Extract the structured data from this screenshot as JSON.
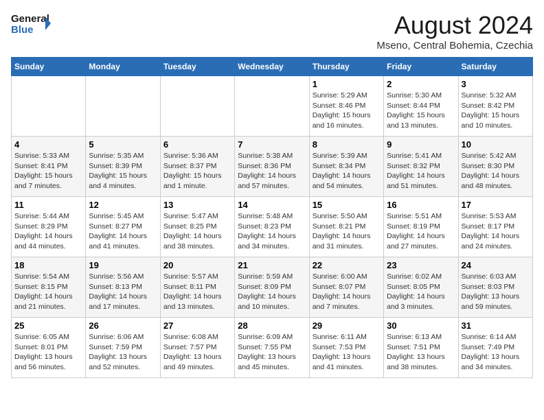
{
  "header": {
    "logo_text_general": "General",
    "logo_text_blue": "Blue",
    "month_year": "August 2024",
    "location": "Mseno, Central Bohemia, Czechia"
  },
  "days_of_week": [
    "Sunday",
    "Monday",
    "Tuesday",
    "Wednesday",
    "Thursday",
    "Friday",
    "Saturday"
  ],
  "weeks": [
    [
      {
        "day": "",
        "info": ""
      },
      {
        "day": "",
        "info": ""
      },
      {
        "day": "",
        "info": ""
      },
      {
        "day": "",
        "info": ""
      },
      {
        "day": "1",
        "info": "Sunrise: 5:29 AM\nSunset: 8:46 PM\nDaylight: 15 hours and 16 minutes."
      },
      {
        "day": "2",
        "info": "Sunrise: 5:30 AM\nSunset: 8:44 PM\nDaylight: 15 hours and 13 minutes."
      },
      {
        "day": "3",
        "info": "Sunrise: 5:32 AM\nSunset: 8:42 PM\nDaylight: 15 hours and 10 minutes."
      }
    ],
    [
      {
        "day": "4",
        "info": "Sunrise: 5:33 AM\nSunset: 8:41 PM\nDaylight: 15 hours and 7 minutes."
      },
      {
        "day": "5",
        "info": "Sunrise: 5:35 AM\nSunset: 8:39 PM\nDaylight: 15 hours and 4 minutes."
      },
      {
        "day": "6",
        "info": "Sunrise: 5:36 AM\nSunset: 8:37 PM\nDaylight: 15 hours and 1 minute."
      },
      {
        "day": "7",
        "info": "Sunrise: 5:38 AM\nSunset: 8:36 PM\nDaylight: 14 hours and 57 minutes."
      },
      {
        "day": "8",
        "info": "Sunrise: 5:39 AM\nSunset: 8:34 PM\nDaylight: 14 hours and 54 minutes."
      },
      {
        "day": "9",
        "info": "Sunrise: 5:41 AM\nSunset: 8:32 PM\nDaylight: 14 hours and 51 minutes."
      },
      {
        "day": "10",
        "info": "Sunrise: 5:42 AM\nSunset: 8:30 PM\nDaylight: 14 hours and 48 minutes."
      }
    ],
    [
      {
        "day": "11",
        "info": "Sunrise: 5:44 AM\nSunset: 8:29 PM\nDaylight: 14 hours and 44 minutes."
      },
      {
        "day": "12",
        "info": "Sunrise: 5:45 AM\nSunset: 8:27 PM\nDaylight: 14 hours and 41 minutes."
      },
      {
        "day": "13",
        "info": "Sunrise: 5:47 AM\nSunset: 8:25 PM\nDaylight: 14 hours and 38 minutes."
      },
      {
        "day": "14",
        "info": "Sunrise: 5:48 AM\nSunset: 8:23 PM\nDaylight: 14 hours and 34 minutes."
      },
      {
        "day": "15",
        "info": "Sunrise: 5:50 AM\nSunset: 8:21 PM\nDaylight: 14 hours and 31 minutes."
      },
      {
        "day": "16",
        "info": "Sunrise: 5:51 AM\nSunset: 8:19 PM\nDaylight: 14 hours and 27 minutes."
      },
      {
        "day": "17",
        "info": "Sunrise: 5:53 AM\nSunset: 8:17 PM\nDaylight: 14 hours and 24 minutes."
      }
    ],
    [
      {
        "day": "18",
        "info": "Sunrise: 5:54 AM\nSunset: 8:15 PM\nDaylight: 14 hours and 21 minutes."
      },
      {
        "day": "19",
        "info": "Sunrise: 5:56 AM\nSunset: 8:13 PM\nDaylight: 14 hours and 17 minutes."
      },
      {
        "day": "20",
        "info": "Sunrise: 5:57 AM\nSunset: 8:11 PM\nDaylight: 14 hours and 13 minutes."
      },
      {
        "day": "21",
        "info": "Sunrise: 5:59 AM\nSunset: 8:09 PM\nDaylight: 14 hours and 10 minutes."
      },
      {
        "day": "22",
        "info": "Sunrise: 6:00 AM\nSunset: 8:07 PM\nDaylight: 14 hours and 7 minutes."
      },
      {
        "day": "23",
        "info": "Sunrise: 6:02 AM\nSunset: 8:05 PM\nDaylight: 14 hours and 3 minutes."
      },
      {
        "day": "24",
        "info": "Sunrise: 6:03 AM\nSunset: 8:03 PM\nDaylight: 13 hours and 59 minutes."
      }
    ],
    [
      {
        "day": "25",
        "info": "Sunrise: 6:05 AM\nSunset: 8:01 PM\nDaylight: 13 hours and 56 minutes."
      },
      {
        "day": "26",
        "info": "Sunrise: 6:06 AM\nSunset: 7:59 PM\nDaylight: 13 hours and 52 minutes."
      },
      {
        "day": "27",
        "info": "Sunrise: 6:08 AM\nSunset: 7:57 PM\nDaylight: 13 hours and 49 minutes."
      },
      {
        "day": "28",
        "info": "Sunrise: 6:09 AM\nSunset: 7:55 PM\nDaylight: 13 hours and 45 minutes."
      },
      {
        "day": "29",
        "info": "Sunrise: 6:11 AM\nSunset: 7:53 PM\nDaylight: 13 hours and 41 minutes."
      },
      {
        "day": "30",
        "info": "Sunrise: 6:13 AM\nSunset: 7:51 PM\nDaylight: 13 hours and 38 minutes."
      },
      {
        "day": "31",
        "info": "Sunrise: 6:14 AM\nSunset: 7:49 PM\nDaylight: 13 hours and 34 minutes."
      }
    ]
  ]
}
